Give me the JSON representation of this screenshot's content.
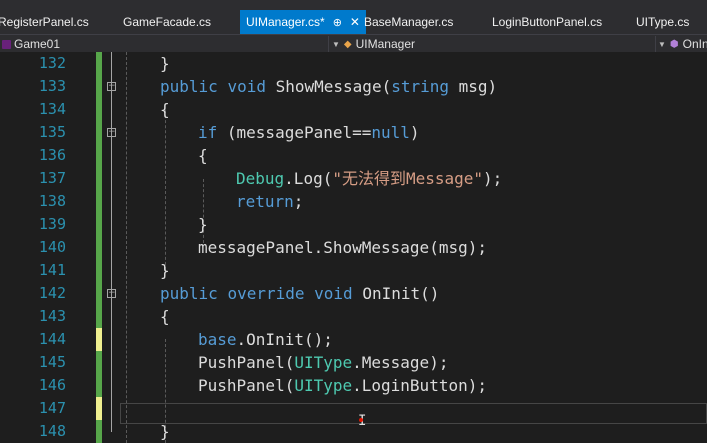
{
  "tabs": [
    {
      "label": "RegisterPanel.cs"
    },
    {
      "label": "GameFacade.cs"
    },
    {
      "label": "UIManager.cs*",
      "pin": "⊕",
      "close": "✕"
    },
    {
      "label": "BaseManager.cs"
    },
    {
      "label": "LoginButtonPanel.cs"
    },
    {
      "label": "UIType.cs"
    }
  ],
  "navbar": {
    "project": "Game01",
    "class": "UIManager",
    "member": "OnInit"
  },
  "editor": {
    "line_numbers": [
      "132",
      "133",
      "134",
      "135",
      "136",
      "137",
      "138",
      "139",
      "140",
      "141",
      "142",
      "143",
      "144",
      "145",
      "146",
      "147",
      "148"
    ],
    "lines": [
      {
        "t": "}"
      },
      {
        "kw1": "public",
        "kw2": "void",
        "name": "ShowMessage",
        "p1": "(",
        "ty": "string",
        "p2": " msg)"
      },
      {
        "t": "{"
      },
      {
        "kw1": "if",
        "rest": " (messagePanel==",
        "kw2": "null",
        ")": ")"
      },
      {
        "t": "{"
      },
      {
        "ty": "Debug",
        "rest": ".Log(",
        "str": "\"无法得到Message\"",
        "end": ");"
      },
      {
        "kw": "return",
        "end": ";"
      },
      {
        "t": "}"
      },
      {
        "t": "messagePanel.ShowMessage(msg);"
      },
      {
        "t": "}"
      },
      {
        "kw1": "public",
        "kw2": "override",
        "kw3": "void",
        "name": "OnInit()"
      },
      {
        "t": "{"
      },
      {
        "kw": "base",
        "rest": ".OnInit();"
      },
      {
        "fn": "PushPanel(",
        "ty": "UIType",
        "rest": ".Message);"
      },
      {
        "fn": "PushPanel(",
        "ty": "UIType",
        "rest": ".LoginButton);"
      },
      {
        "t": ""
      },
      {
        "t": "}"
      }
    ]
  },
  "colors": {
    "keyword": "#569cd6",
    "type": "#4ec9b0",
    "string": "#d69d85",
    "line_number": "#2b91af",
    "saved_change": "#57a64a",
    "unsaved_change": "#efef8f",
    "active_tab": "#007acc"
  }
}
